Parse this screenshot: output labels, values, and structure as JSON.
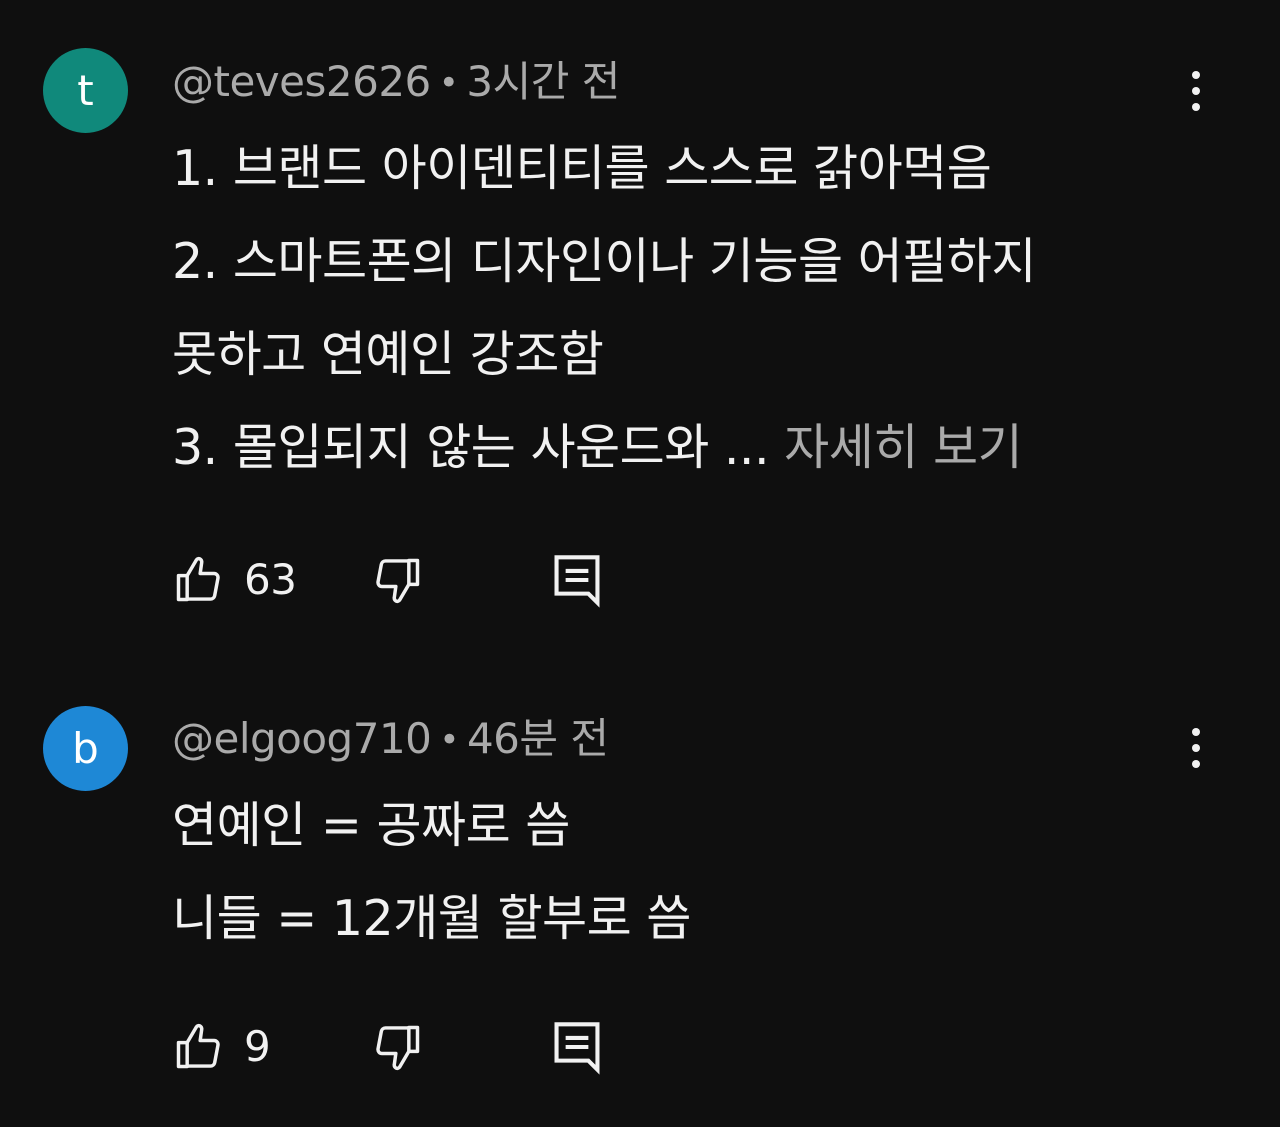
{
  "comments": [
    {
      "avatar": {
        "letter": "t",
        "color": "#10897b"
      },
      "username": "@teves2626",
      "separator": "•",
      "time": "3시간 전",
      "lines": [
        "1. 브랜드 아이덴티티를 스스로 갉아먹음",
        "2. 스마트폰의 디자인이나 기능을 어필하지",
        "못하고 연예인 강조함",
        "3. 몰입되지 않는 사운드와 ..."
      ],
      "read_more": "자세히 보기",
      "likes": "63",
      "icons": {
        "like": "thumbs-up-icon",
        "dislike": "thumbs-down-icon",
        "reply": "reply-icon",
        "more": "more-vert-icon"
      }
    },
    {
      "avatar": {
        "letter": "b",
        "color": "#1e88d6"
      },
      "username": "@elgoog710",
      "separator": "•",
      "time": "46분 전",
      "lines": [
        "연예인 = 공짜로 씀",
        "니들 = 12개월 할부로 씀"
      ],
      "likes": "9",
      "icons": {
        "like": "thumbs-up-icon",
        "dislike": "thumbs-down-icon",
        "reply": "reply-icon",
        "more": "more-vert-icon"
      }
    }
  ],
  "colors": {
    "background": "#0f0f0f",
    "text_primary": "#f1f1f1",
    "text_secondary": "#aaaaaa"
  }
}
